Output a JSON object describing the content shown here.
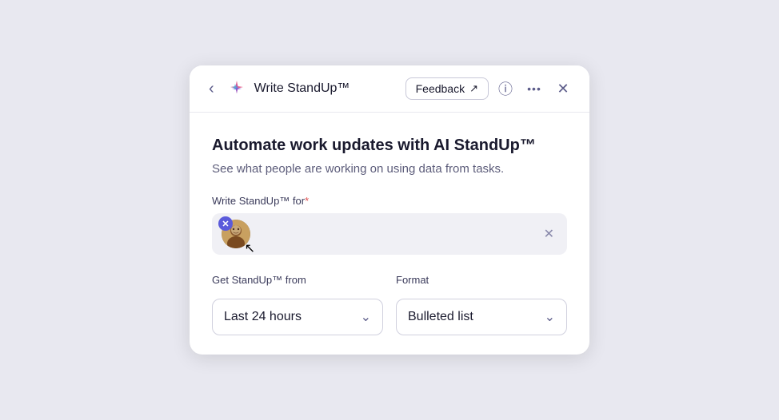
{
  "header": {
    "back_label": "‹",
    "title": "Write StandUp™",
    "feedback_label": "Feedback",
    "feedback_icon": "↗",
    "info_icon": "ⓘ",
    "more_icon": "···",
    "close_icon": "✕"
  },
  "content": {
    "main_title": "Automate work updates with AI StandUp™",
    "subtitle": "See what people are working on using data from tasks.",
    "for_label": "Write StandUp™ for",
    "required_star": "*",
    "clear_icon": "✕",
    "standup_from_label": "Get StandUp™ from",
    "standup_from_value": "Last 24 hours",
    "format_label": "Format",
    "format_value": "Bulleted list",
    "chevron": "⌄"
  },
  "colors": {
    "accent": "#5b5bdb",
    "star_pink": "#e05080",
    "star_blue": "#5b8bdb",
    "star_yellow": "#f0c040"
  }
}
